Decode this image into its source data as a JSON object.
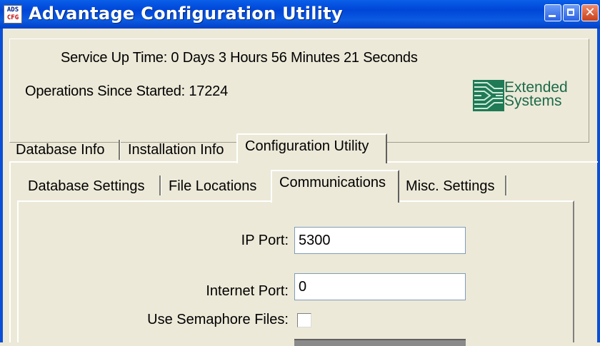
{
  "window": {
    "title": "Advantage Configuration Utility",
    "icon_lines": [
      "ADS",
      "CFG"
    ],
    "buttons": [
      "minimize",
      "maximize",
      "close"
    ],
    "colors": {
      "titlebar": "#0046d8",
      "background": "#ece9d8",
      "close_button": "#c8401b"
    }
  },
  "info": {
    "uptime": "Service Up Time: 0 Days 3 Hours 56 Minutes 21 Seconds",
    "operations": "Operations Since Started: 17224",
    "logo": {
      "line1": "Extended",
      "line2": "Systems",
      "icon": "extended-systems-logo"
    }
  },
  "main_tabs": [
    {
      "label": "Database Info",
      "active": false
    },
    {
      "label": "Installation Info",
      "active": false
    },
    {
      "label": "Configuration Utility",
      "active": true
    }
  ],
  "sub_tabs": [
    {
      "label": "Database Settings",
      "active": false
    },
    {
      "label": "File Locations",
      "active": false
    },
    {
      "label": "Communications",
      "active": true
    },
    {
      "label": "Misc. Settings",
      "active": false
    }
  ],
  "communications": {
    "ip_port": {
      "label": "IP Port:",
      "value": "5300"
    },
    "internet_port": {
      "label": "Internet Port:",
      "value": "0"
    },
    "semaphore": {
      "label": "Use Semaphore Files:",
      "checked": false
    }
  }
}
